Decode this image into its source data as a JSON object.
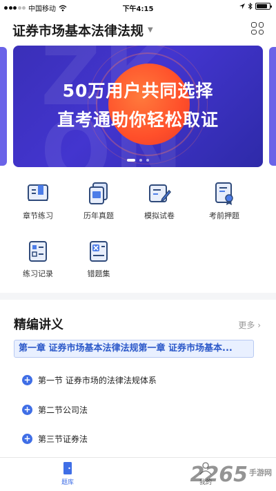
{
  "status_bar": {
    "carrier": "中国移动",
    "time": "下午4:15",
    "battery_level": 0.85
  },
  "header": {
    "title": "证券市场基本法律法规",
    "dropdown_icon": "caret-down-icon",
    "menu_icon": "grid-icon"
  },
  "banner": {
    "line1": "50万用户共同选择",
    "line2": "直考通助你轻松取证",
    "active_slide": 1,
    "slide_count": 3
  },
  "features": [
    {
      "label": "章节练习",
      "icon": "book-icon"
    },
    {
      "label": "历年真题",
      "icon": "paper-stack-icon"
    },
    {
      "label": "模拟试卷",
      "icon": "pen-paper-icon"
    },
    {
      "label": "考前押题",
      "icon": "certificate-icon"
    },
    {
      "label": "练习记录",
      "icon": "checklist-icon"
    },
    {
      "label": "错题集",
      "icon": "error-book-icon"
    }
  ],
  "lecture": {
    "title": "精编讲义",
    "more_label": "更多",
    "chapter": "第一章 证券市场基本法律法规第一章 证券市场基本...",
    "sections": [
      "第一节 证券市场的法律法规体系",
      "第二节公司法",
      "第三节证券法"
    ]
  },
  "tabbar": {
    "tabs": [
      {
        "label": "题库",
        "active": true
      },
      {
        "label": "我的",
        "active": false
      }
    ]
  },
  "watermark": {
    "brand": "2265",
    "sub": "手游网"
  },
  "colors": {
    "accent": "#3f6ee6",
    "banner_bg": "#3a2fb8",
    "banner_sun": "#ff5a2a"
  }
}
